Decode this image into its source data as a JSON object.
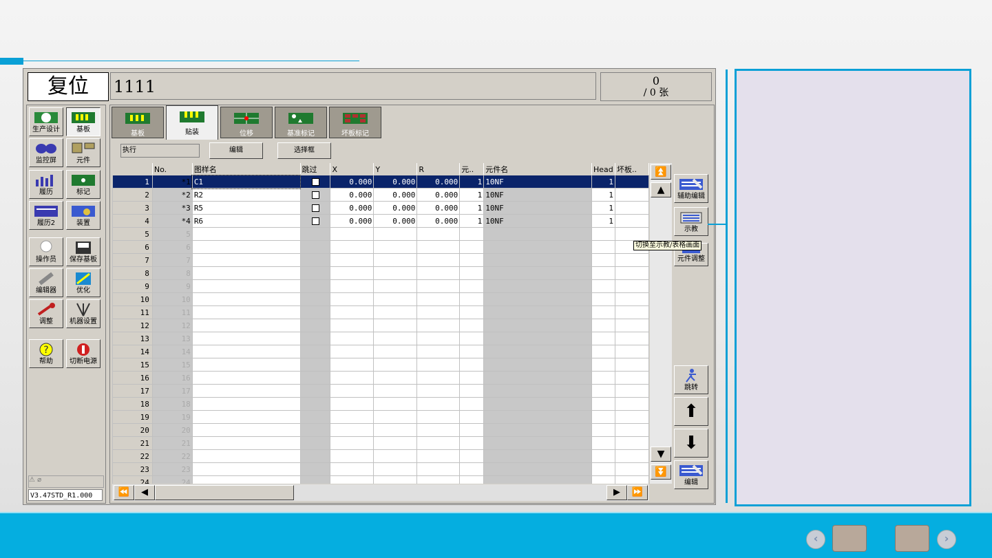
{
  "header": {
    "status": "复位",
    "code": "1111",
    "count_current": "0",
    "count_total": "/ 0 张"
  },
  "sidebar": {
    "items": [
      {
        "label": "生产设计",
        "icon": "production-design-icon"
      },
      {
        "label": "基板",
        "icon": "board-icon",
        "active": true
      },
      {
        "label": "监控屏",
        "icon": "monitor-icon"
      },
      {
        "label": "元件",
        "icon": "component-icon"
      },
      {
        "label": "履历",
        "icon": "history-icon"
      },
      {
        "label": "标记",
        "icon": "mark-icon"
      },
      {
        "label": "履历2",
        "icon": "history2-icon"
      },
      {
        "label": "装置",
        "icon": "device-icon"
      },
      {
        "label": "操作员",
        "icon": "operator-icon"
      },
      {
        "label": "保存基板",
        "icon": "save-board-icon"
      },
      {
        "label": "编辑器",
        "icon": "editor-icon"
      },
      {
        "label": "优化",
        "icon": "optimize-icon"
      },
      {
        "label": "调整",
        "icon": "adjust-icon"
      },
      {
        "label": "机器设置",
        "icon": "machine-settings-icon"
      },
      {
        "label": "帮助",
        "icon": "help-icon"
      },
      {
        "label": "切断电源",
        "icon": "power-off-icon"
      }
    ],
    "version": "V3.47STD_R1.000"
  },
  "tabs": [
    {
      "label": "基板"
    },
    {
      "label": "贴装",
      "active": true
    },
    {
      "label": "位移"
    },
    {
      "label": "基准标记"
    },
    {
      "label": "坏板标记"
    }
  ],
  "toolbar": {
    "exec_label": "执行",
    "edit_label": "编辑",
    "select_label": "选择框"
  },
  "table": {
    "headers": [
      "",
      "No.",
      "图样名",
      "跳过",
      "X",
      "Y",
      "R",
      "元..",
      "元件名",
      "Head",
      "坏板.."
    ],
    "rows": [
      {
        "idx": "1",
        "no": "*1",
        "pattern": "C1",
        "skip": true,
        "x": "0.000",
        "y": "0.000",
        "r": "0.000",
        "comp_count": "1",
        "comp": "10NF",
        "head": "1",
        "selected": true
      },
      {
        "idx": "2",
        "no": "*2",
        "pattern": "R2",
        "skip": true,
        "x": "0.000",
        "y": "0.000",
        "r": "0.000",
        "comp_count": "1",
        "comp": "10NF",
        "head": "1"
      },
      {
        "idx": "3",
        "no": "*3",
        "pattern": "R5",
        "skip": true,
        "x": "0.000",
        "y": "0.000",
        "r": "0.000",
        "comp_count": "1",
        "comp": "10NF",
        "head": "1"
      },
      {
        "idx": "4",
        "no": "*4",
        "pattern": "R6",
        "skip": true,
        "x": "0.000",
        "y": "0.000",
        "r": "0.000",
        "comp_count": "1",
        "comp": "10NF",
        "head": "1"
      },
      {
        "idx": "5",
        "no": "5"
      },
      {
        "idx": "6",
        "no": "6"
      },
      {
        "idx": "7",
        "no": "7"
      },
      {
        "idx": "8",
        "no": "8"
      },
      {
        "idx": "9",
        "no": "9"
      },
      {
        "idx": "10",
        "no": "10"
      },
      {
        "idx": "11",
        "no": "11"
      },
      {
        "idx": "12",
        "no": "12"
      },
      {
        "idx": "13",
        "no": "13"
      },
      {
        "idx": "14",
        "no": "14"
      },
      {
        "idx": "15",
        "no": "15"
      },
      {
        "idx": "16",
        "no": "16"
      },
      {
        "idx": "17",
        "no": "17"
      },
      {
        "idx": "18",
        "no": "18"
      },
      {
        "idx": "19",
        "no": "19"
      },
      {
        "idx": "20",
        "no": "20"
      },
      {
        "idx": "21",
        "no": "21"
      },
      {
        "idx": "22",
        "no": "22"
      },
      {
        "idx": "23",
        "no": "23"
      },
      {
        "idx": "24",
        "no": "24"
      }
    ]
  },
  "right_buttons": {
    "assist_edit": "辅助编辑",
    "teach": "示教",
    "comp_adjust": "元件调整",
    "jump": "跳转",
    "edit": "编辑"
  },
  "tooltip": "切换至示教/表格画面",
  "colors": {
    "accent": "#0aa0d6",
    "selection": "#0a246a",
    "window": "#d4d0c8"
  }
}
